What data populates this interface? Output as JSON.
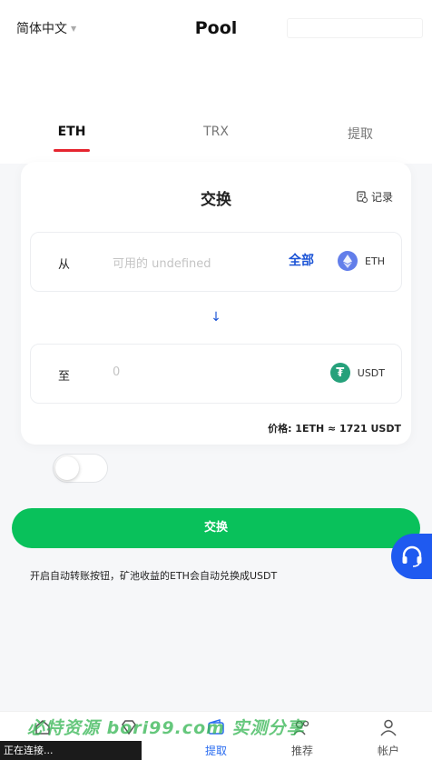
{
  "header": {
    "language": "简体中文",
    "title": "Pool"
  },
  "tabs": [
    {
      "label": "ETH",
      "active": true
    },
    {
      "label": "TRX",
      "active": false
    },
    {
      "label": "提取",
      "active": false
    }
  ],
  "exchange": {
    "title": "交换",
    "records_label": "记录",
    "from": {
      "label": "从",
      "placeholder": "可用的 undefined",
      "all_label": "全部",
      "coin": "ETH"
    },
    "arrow": "↓",
    "to": {
      "label": "至",
      "value": "0",
      "coin": "USDT"
    },
    "price": "价格: 1ETH ≈ 1721 USDT"
  },
  "auto_convert_toggle": {
    "on": false
  },
  "main_button": "交换",
  "note": "开启自动转账按钮，矿池收益的ETH会自动兑换成USDT",
  "bottom_nav": [
    {
      "label": "首页",
      "icon": "home-icon"
    },
    {
      "label": "矿池",
      "icon": "diamond-icon"
    },
    {
      "label": "提取",
      "icon": "wallet-icon",
      "active": true
    },
    {
      "label": "推荐",
      "icon": "users-icon"
    },
    {
      "label": "帐户",
      "icon": "user-icon"
    }
  ],
  "watermark": "必特资源 bori99.com 实测分享",
  "status_bar": "正在连接...",
  "colors": {
    "accent_blue": "#1c54d6",
    "button_green": "#09c15b",
    "tab_underline": "#e5252f",
    "nav_active": "#2a6cf0"
  }
}
